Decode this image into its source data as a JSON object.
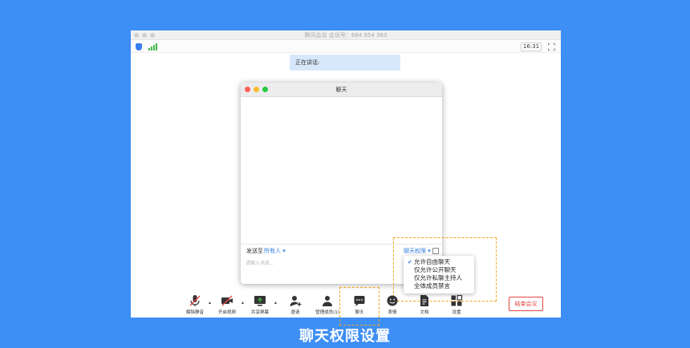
{
  "window": {
    "title": "腾讯会议  会议号：684 954 363",
    "time": "16:31"
  },
  "speaking": {
    "label": "正在讲话:"
  },
  "chat": {
    "title": "聊天",
    "send_to_label": "发送至",
    "send_to_target": "所有人 ▾",
    "permission_link": "聊天权限 ▾",
    "input_placeholder": "请输入消息..."
  },
  "permission_menu": {
    "items": [
      {
        "label": "允许自由聊天",
        "checked": true
      },
      {
        "label": "仅允许公开聊天",
        "checked": false
      },
      {
        "label": "仅允许私聊主持人",
        "checked": false
      },
      {
        "label": "全体成员禁言",
        "checked": false
      }
    ],
    "check_mark": "✔"
  },
  "toolbar": {
    "items": [
      {
        "label": "解除静音",
        "icon": "mic-muted-icon"
      },
      {
        "label": "开启视频",
        "icon": "camera-off-icon"
      },
      {
        "label": "共享屏幕",
        "icon": "share-screen-icon"
      },
      {
        "label": "邀请",
        "icon": "invite-icon"
      },
      {
        "label": "管理成员(1)",
        "icon": "members-icon"
      },
      {
        "label": "聊天",
        "icon": "chat-icon"
      },
      {
        "label": "表情",
        "icon": "emoji-icon"
      },
      {
        "label": "文档",
        "icon": "document-icon"
      },
      {
        "label": "设置",
        "icon": "settings-icon"
      }
    ],
    "caret": "▴",
    "end_meeting": "结束会议"
  },
  "caption": "聊天权限设置",
  "colors": {
    "background": "#3d8ef5",
    "accent": "#2f7de1",
    "highlight": "#f3a51c",
    "end": "#e54545"
  }
}
